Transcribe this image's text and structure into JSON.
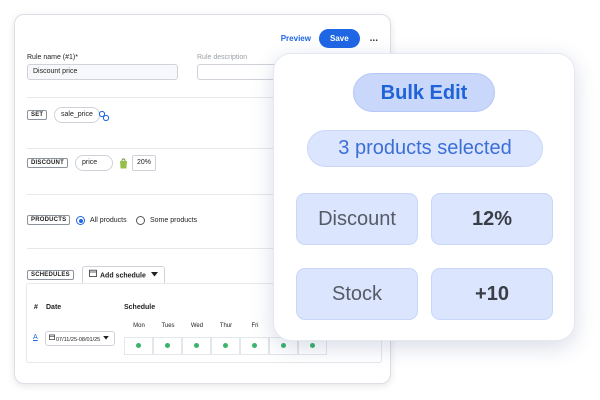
{
  "editor": {
    "actions": {
      "preview": "Preview",
      "save": "Save",
      "more": "..."
    },
    "rule_name": {
      "label": "Rule name (#1)*",
      "value": "Discount price"
    },
    "rule_description": {
      "placeholder": "Rule description"
    },
    "set": {
      "tag": "SET",
      "field": "sale_price"
    },
    "discount": {
      "tag": "DISCOUNT",
      "field": "price",
      "value": "20%"
    },
    "products": {
      "tag": "PRODUCTS",
      "option_all": "All products",
      "option_some": "Some products",
      "selected": "All products"
    },
    "schedules": {
      "tag": "SCHEDULES",
      "add_button": "Add schedule",
      "columns": {
        "num": "#",
        "date": "Date",
        "schedule": "Schedule"
      },
      "row": {
        "letter": "A",
        "date_range": "07/11/25-08/01/25"
      },
      "days": [
        "Mon",
        "Tues",
        "Wed",
        "Thur",
        "Fri",
        "",
        ""
      ]
    }
  },
  "bulk": {
    "title": "Bulk Edit",
    "selected": "3 products selected",
    "discount_label": "Discount",
    "discount_value": "12%",
    "stock_label": "Stock",
    "stock_value": "+10"
  },
  "colors": {
    "accent": "#1f66e5",
    "bulk_title_bg": "#c9d7fb",
    "bulk_cell_bg": "#dbe5fd",
    "schedule_dot": "#3ab36b",
    "shopify_green": "#96bf48"
  },
  "icons": {
    "sync": "sync-icon",
    "shopify": "shopify-bag-icon",
    "calendar": "calendar-icon",
    "dropdown": "caret-down-icon"
  }
}
